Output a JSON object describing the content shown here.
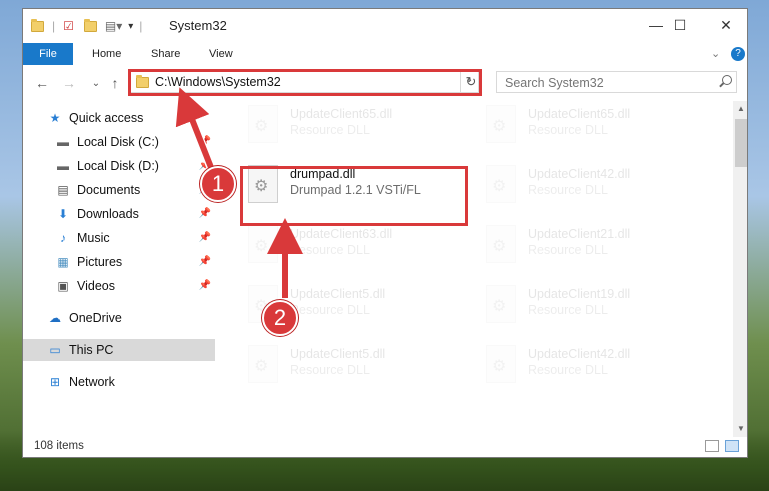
{
  "window": {
    "title": "System32",
    "controls": {
      "minimize": "—",
      "maximize": "☐",
      "close": "✕"
    }
  },
  "ribbon": {
    "tabs": [
      "File",
      "Home",
      "Share",
      "View"
    ],
    "expand_glyph": "⌄",
    "help_glyph": "?"
  },
  "nav": {
    "back": "←",
    "forward": "→",
    "recent": "⌄",
    "up": "↑",
    "address": "C:\\Windows\\System32",
    "address_dropdown": "⌄",
    "refresh": "↻",
    "search_placeholder": "Search System32"
  },
  "sidebar": {
    "items": [
      {
        "label": "Quick access",
        "icon": "star-icon",
        "glyph": "★"
      },
      {
        "label": "Local Disk (C:)",
        "icon": "drive-icon",
        "glyph": "▬",
        "pinned": true
      },
      {
        "label": "Local Disk (D:)",
        "icon": "drive-icon",
        "glyph": "▬",
        "pinned": true
      },
      {
        "label": "Documents",
        "icon": "documents-icon",
        "glyph": "▤",
        "pinned": true
      },
      {
        "label": "Downloads",
        "icon": "download-icon",
        "glyph": "⬇",
        "pinned": true
      },
      {
        "label": "Music",
        "icon": "music-icon",
        "glyph": "♪",
        "pinned": true
      },
      {
        "label": "Pictures",
        "icon": "pictures-icon",
        "glyph": "▦",
        "pinned": true
      },
      {
        "label": "Videos",
        "icon": "videos-icon",
        "glyph": "▣",
        "pinned": true
      },
      {
        "label": "OneDrive",
        "icon": "cloud-icon",
        "glyph": "☁"
      },
      {
        "label": "This PC",
        "icon": "computer-icon",
        "glyph": "▭",
        "selected": true
      },
      {
        "label": "Network",
        "icon": "network-icon",
        "glyph": "⊞"
      }
    ],
    "pin_glyph": "📌"
  },
  "files": {
    "highlighted": {
      "name": "drumpad.dll",
      "description": "Drumpad 1.2.1 VSTi/FL"
    },
    "background": [
      {
        "name": "UpdateClient65.dll",
        "description": "Resource DLL"
      },
      {
        "name": "UpdateClient65.dll",
        "description": "Resource DLL"
      },
      {
        "name": "UpdateClient42.dll",
        "description": "Resource DLL"
      },
      {
        "name": "UpdateClient63.dll",
        "description": "Resource DLL"
      },
      {
        "name": "UpdateClient21.dll",
        "description": "Resource DLL"
      },
      {
        "name": "UpdateClient5.dll",
        "description": "Resource DLL"
      },
      {
        "name": "UpdateClient19.dll",
        "description": "Resource DLL"
      },
      {
        "name": "UpdateClient5.dll",
        "description": "Resource DLL"
      },
      {
        "name": "UpdateClient42.dll",
        "description": "Resource DLL"
      }
    ]
  },
  "status": {
    "item_count": "108 items"
  },
  "annotations": {
    "marker_1": "1",
    "marker_2": "2",
    "color": "#d9393a"
  }
}
